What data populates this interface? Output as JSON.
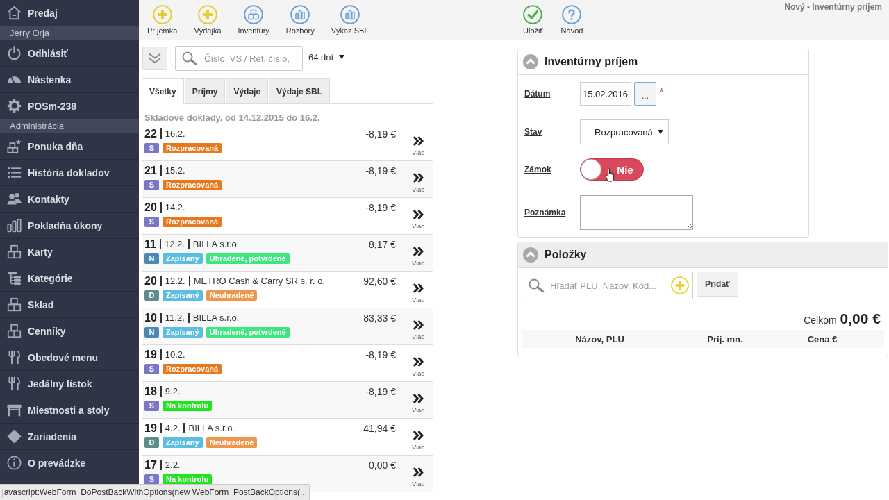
{
  "sidebar": {
    "items": [
      {
        "kind": "link",
        "label": "Predaj"
      },
      {
        "kind": "section",
        "label": "Jerry Orja"
      },
      {
        "kind": "link",
        "label": "Odhlásiť"
      },
      {
        "kind": "link",
        "label": "Nástenka"
      },
      {
        "kind": "link",
        "label": "POSm-238"
      },
      {
        "kind": "section",
        "label": "Administrácia"
      },
      {
        "kind": "link",
        "label": "Ponuka dňa"
      },
      {
        "kind": "link",
        "label": "História dokladov"
      },
      {
        "kind": "link",
        "label": "Kontakty"
      },
      {
        "kind": "link",
        "label": "Pokladňa úkony"
      },
      {
        "kind": "link",
        "label": "Karty"
      },
      {
        "kind": "link",
        "label": "Kategórie"
      },
      {
        "kind": "link",
        "label": "Sklad"
      },
      {
        "kind": "link",
        "label": "Cenníky"
      },
      {
        "kind": "link",
        "label": "Obedové menu"
      },
      {
        "kind": "link",
        "label": "Jedálny lístok"
      },
      {
        "kind": "link",
        "label": "Miestnosti a stoly"
      },
      {
        "kind": "link",
        "label": "Zariadenia"
      },
      {
        "kind": "link",
        "label": "O prevádzke"
      }
    ]
  },
  "toolbar": {
    "actions": [
      {
        "label": "Príjemka"
      },
      {
        "label": "Výdajka"
      },
      {
        "label": "Inventúry"
      },
      {
        "label": "Rozbory"
      },
      {
        "label": "Výkaz SBL"
      }
    ],
    "form_actions": [
      {
        "label": "Uložiť"
      },
      {
        "label": "Návod"
      }
    ],
    "title": "Nový - Inventúrny príjem"
  },
  "documents": {
    "search": {
      "placeholder": "Číslo, VS / Ref. číslo,"
    },
    "period": "64 dní",
    "tabs": [
      {
        "label": "Všetky",
        "selected": true
      },
      {
        "label": "Príjmy",
        "selected": false
      },
      {
        "label": "Výdaje",
        "selected": false
      },
      {
        "label": "Výdaje SBL",
        "selected": false
      }
    ],
    "heading": "Skladové doklady, od 14.12.2015 do 16.2.",
    "rows": [
      {
        "number": "22",
        "date": "16.2.",
        "amount": "-8,19 €",
        "more": "Viac",
        "badges": [
          {
            "text": "S",
            "color": "#7b76c9"
          },
          {
            "text": "Rozpracovaná",
            "color": "#e8781e"
          }
        ]
      },
      {
        "number": "21",
        "date": "15.2.",
        "amount": "-8,19 €",
        "more": "Viac",
        "badges": [
          {
            "text": "S",
            "color": "#7b76c9"
          },
          {
            "text": "Rozpracovaná",
            "color": "#e8781e"
          }
        ]
      },
      {
        "number": "20",
        "date": "14.2.",
        "amount": "-8,19 €",
        "more": "Viac",
        "badges": [
          {
            "text": "S",
            "color": "#7b76c9"
          },
          {
            "text": "Rozpracovaná",
            "color": "#e8781e"
          }
        ]
      },
      {
        "number": "11",
        "date": "12.2.",
        "partner": "BILLA s.r.o.",
        "amount": "8,17 €",
        "more": "Viac",
        "badges": [
          {
            "text": "N",
            "color": "#4a89b4"
          },
          {
            "text": "Zapísaný",
            "color": "#5bbde0"
          },
          {
            "text": "Uhradené, potvrdené",
            "color": "#3de67e"
          }
        ]
      },
      {
        "number": "20",
        "date": "12.2.",
        "partner": "METRO Cash & Carry SR s. r. o.",
        "amount": "92,60 €",
        "more": "Viac",
        "badges": [
          {
            "text": "D",
            "color": "#5d8c8c"
          },
          {
            "text": "Zapísaný",
            "color": "#5bbde0"
          },
          {
            "text": "Neuhradené",
            "color": "#f0964c"
          }
        ]
      },
      {
        "number": "10",
        "date": "11.2.",
        "partner": "BILLA s.r.o.",
        "amount": "83,33 €",
        "more": "Viac",
        "badges": [
          {
            "text": "N",
            "color": "#4a89b4"
          },
          {
            "text": "Zapísaný",
            "color": "#5bbde0"
          },
          {
            "text": "Uhradené, potvrdené",
            "color": "#3de67e"
          }
        ]
      },
      {
        "number": "19",
        "date": "10.2.",
        "amount": "-8,19 €",
        "more": "Viac",
        "badges": [
          {
            "text": "S",
            "color": "#7b76c9"
          },
          {
            "text": "Rozpracovaná",
            "color": "#e8781e"
          }
        ]
      },
      {
        "number": "18",
        "date": "9.2.",
        "amount": "-8,19 €",
        "more": "Viac",
        "badges": [
          {
            "text": "S",
            "color": "#7b76c9"
          },
          {
            "text": "Na kontrolu",
            "color": "#1ee61e"
          }
        ]
      },
      {
        "number": "19",
        "date": "4.2.",
        "partner": "BILLA s.r.o.",
        "amount": "41,94 €",
        "more": "Viac",
        "badges": [
          {
            "text": "D",
            "color": "#5d8c8c"
          },
          {
            "text": "Zapísaný",
            "color": "#5bbde0"
          },
          {
            "text": "Neuhradené",
            "color": "#f0964c"
          }
        ]
      },
      {
        "number": "17",
        "date": "2.2.",
        "amount": "0,00 €",
        "more": "Viac",
        "badges": [
          {
            "text": "S",
            "color": "#7b76c9"
          },
          {
            "text": "Na kontrolu",
            "color": "#1ee61e"
          }
        ]
      }
    ]
  },
  "form": {
    "title": "Inventúrny príjem",
    "date": {
      "label": "Dátum",
      "value": "15.02.2016",
      "picker": "...",
      "required_mark": "*"
    },
    "status": {
      "label": "Stav",
      "value": "Rozpracovaná"
    },
    "lock": {
      "label": "Zámok",
      "on": false,
      "text": "Nie"
    },
    "note": {
      "label": "Poznámka"
    }
  },
  "items": {
    "title": "Položky",
    "search": {
      "placeholder": "Hľadať PLU, Názov, Kód..."
    },
    "add_button": "Pridať",
    "total_label": "Celkom",
    "total": "0,00 €",
    "columns": [
      "Názov, PLU",
      "Prij. mn.",
      "Cena €"
    ]
  },
  "status_bar": {
    "text": "javascript:WebForm_DoPostBackWithOptions(new WebForm_PostBackOptions(..."
  }
}
